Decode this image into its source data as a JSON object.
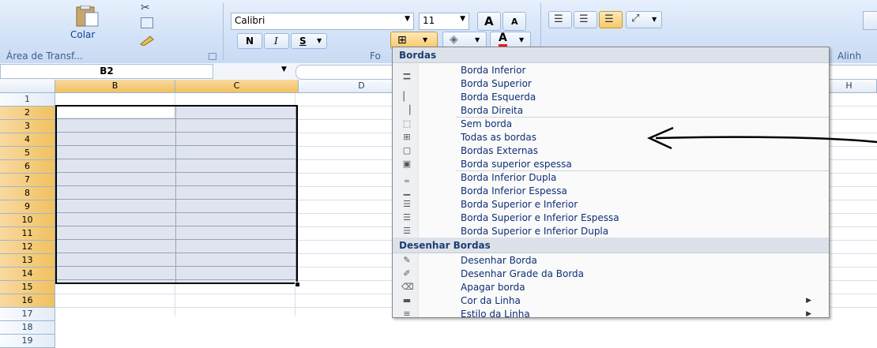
{
  "ribbon": {
    "paste_label": "Colar",
    "clipboard_group": "Área de Transf...",
    "font_group": "Fo",
    "align_group": "Alinh",
    "font_name": "Calibri",
    "font_size": "11",
    "bold": "N",
    "italic": "I",
    "underline": "S",
    "grow_font": "A",
    "shrink_font": "A"
  },
  "formula_bar": {
    "name_box": "B2"
  },
  "columns": [
    "B",
    "C",
    "D",
    "H"
  ],
  "rows": [
    "1",
    "2",
    "3",
    "4",
    "5",
    "6",
    "7",
    "8",
    "9",
    "10",
    "11",
    "12",
    "13",
    "14",
    "15",
    "16",
    "17",
    "18",
    "19"
  ],
  "menu": {
    "header_borders": "Bordas",
    "header_draw": "Desenhar Bordas",
    "border_items": [
      "Borda Inferior",
      "Borda Superior",
      "Borda Esquerda",
      "Borda Direita",
      "Sem borda",
      "Todas as bordas",
      "Bordas Externas",
      "Borda superior espessa",
      "Borda Inferior Dupla",
      "Borda Inferior Espessa",
      "Borda Superior e Inferior",
      "Borda Superior e Inferior Espessa",
      "Borda Superior e Inferior Dupla"
    ],
    "draw_items": [
      "Desenhar Borda",
      "Desenhar Grade da Borda",
      "Apagar borda",
      "Cor da Linha",
      "Estilo da Linha"
    ]
  },
  "colors": {
    "accent": "#f1c15f",
    "ribbon": "#d4e3f8",
    "menu_text": "#0e2f75"
  }
}
